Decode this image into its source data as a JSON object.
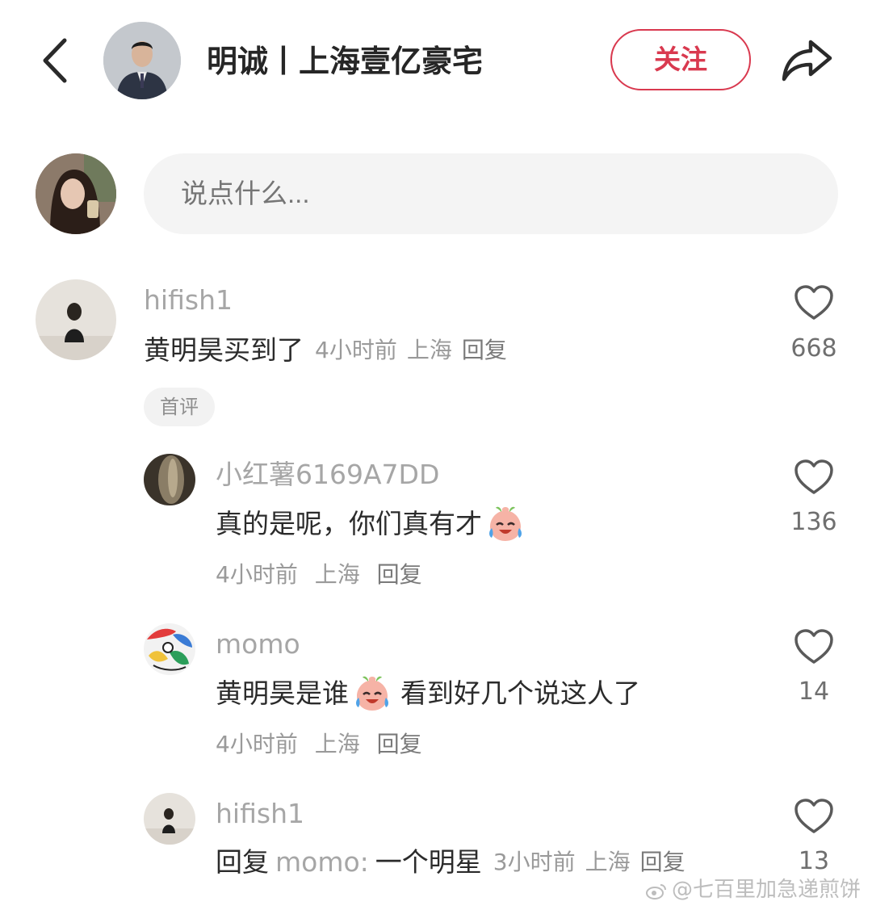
{
  "header": {
    "title": "明诚丨上海壹亿豪宅",
    "follow_label": "关注"
  },
  "comment_input": {
    "placeholder": "说点什么..."
  },
  "comments": [
    {
      "username": "hifish1",
      "text": "黄明昊买到了",
      "time": "4小时前",
      "location": "上海",
      "reply_label": "回复",
      "likes": "668",
      "badge": "首评"
    }
  ],
  "replies": [
    {
      "username": "小红薯6169A7DD",
      "text": "真的是呢，你们真有才",
      "time": "4小时前",
      "location": "上海",
      "reply_label": "回复",
      "likes": "136",
      "emoji": "crying-laughing-face"
    },
    {
      "username": "momo",
      "text_before": "黄明昊是谁",
      "text_after": "看到好几个说这人了",
      "time": "4小时前",
      "location": "上海",
      "reply_label": "回复",
      "likes": "14",
      "emoji": "crying-laughing-face"
    },
    {
      "username": "hifish1",
      "reply_prefix": "回复",
      "reply_target": "momo:",
      "text": "一个明星",
      "time": "3小时前",
      "location": "上海",
      "reply_label": "回复",
      "likes": "13"
    }
  ],
  "watermark": "@七百里加急递煎饼",
  "colors": {
    "accent": "#d9394f",
    "muted_text": "#a6a6a6",
    "input_bg": "#f4f4f4"
  }
}
